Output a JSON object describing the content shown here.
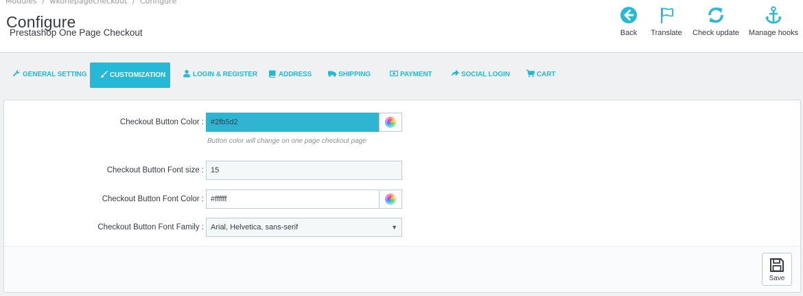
{
  "breadcrumb": [
    "Modules",
    "/",
    "wkonepagecheckout",
    "/",
    "Configure"
  ],
  "header": {
    "title": "Configure",
    "subtitle": "Prestashop One Page Checkout"
  },
  "toolbar": {
    "back": {
      "label": "Back",
      "icon": "back-arrow-icon"
    },
    "translate": {
      "label": "Translate",
      "icon": "flag-icon"
    },
    "check_update": {
      "label": "Check update",
      "icon": "refresh-icon"
    },
    "manage_hooks": {
      "label": "Manage hooks",
      "icon": "anchor-icon"
    }
  },
  "tabs": [
    {
      "label": "GENERAL SETTING",
      "icon": "wrench-icon"
    },
    {
      "label": "CUSTOMIZATION",
      "icon": "brush-icon",
      "active": true
    },
    {
      "label": "LOGIN & REGISTER",
      "icon": "user-icon"
    },
    {
      "label": "ADDRESS",
      "icon": "book-icon"
    },
    {
      "label": "SHIPPING",
      "icon": "truck-icon"
    },
    {
      "label": "PAYMENT",
      "icon": "money-icon"
    },
    {
      "label": "SOCIAL LOGIN",
      "icon": "share-icon"
    },
    {
      "label": "CART",
      "icon": "cart-icon"
    }
  ],
  "form": {
    "button_color": {
      "label": "Checkout Button Color :",
      "value": "#2fb5d2",
      "help": "Button color will change on one page checkout page"
    },
    "font_size": {
      "label": "Checkout Button Font size :",
      "value": "15"
    },
    "font_color": {
      "label": "Checkout Button Font Color :",
      "value": "#ffffff"
    },
    "font_family": {
      "label": "Checkout Button Font Family :",
      "value": "Arial, Helvetica, sans-serif"
    }
  },
  "footer": {
    "save_label": "Save"
  },
  "colors": {
    "accent": "#25b9d7",
    "button_color_swatch": "#2fb5d2"
  }
}
